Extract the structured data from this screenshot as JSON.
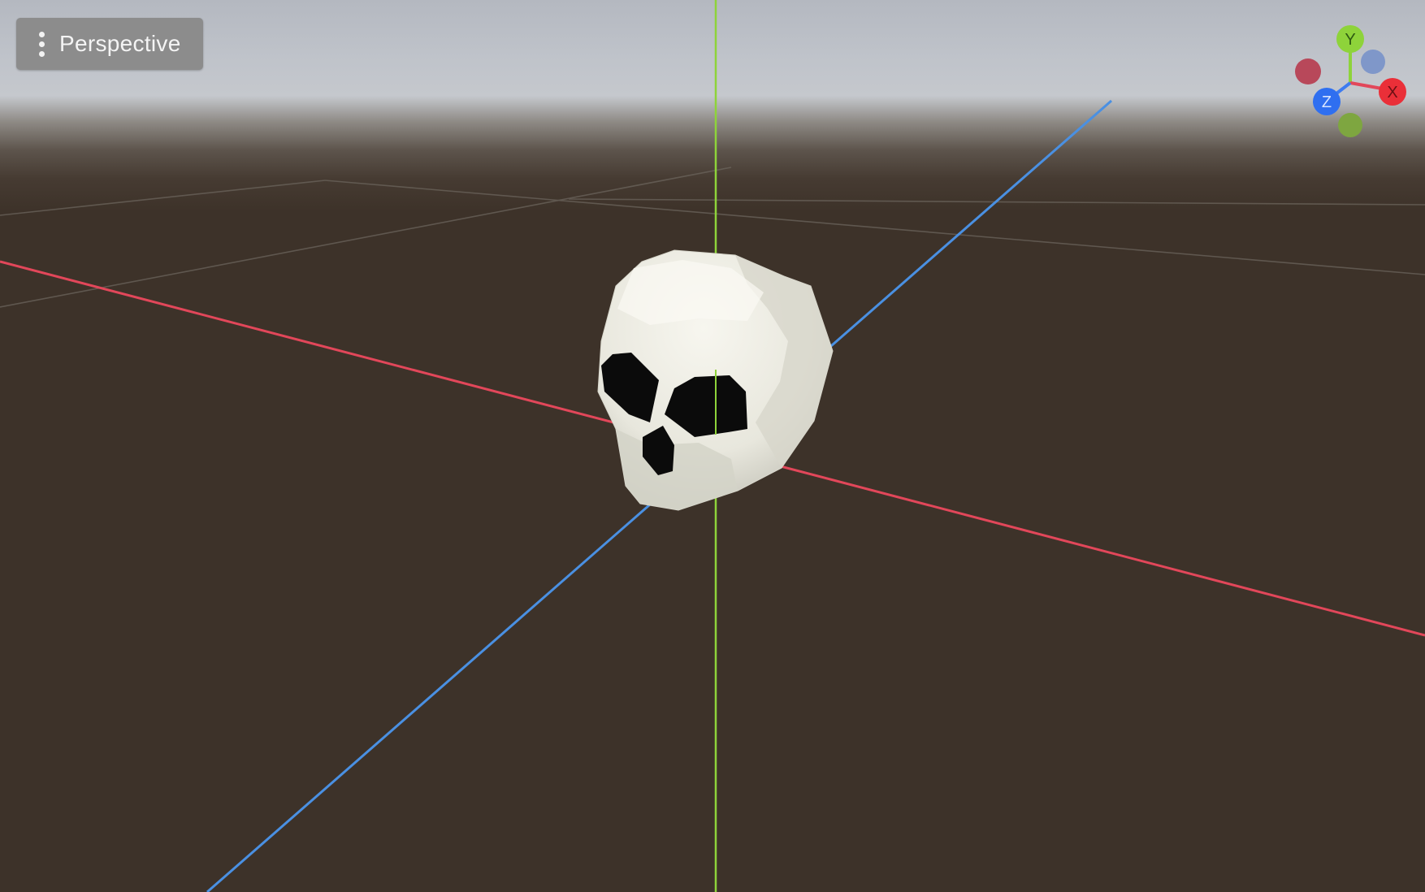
{
  "viewport": {
    "view_mode": "Perspective"
  },
  "axis_gizmo": {
    "x_label": "X",
    "y_label": "Y",
    "z_label": "Z"
  },
  "colors": {
    "x_axis": "#e2475a",
    "y_axis": "#8ed33a",
    "z_axis": "#4a90e2",
    "ground": "#3d3229",
    "skull": "#ecebe2"
  },
  "icons": [
    "kebab-menu-icon",
    "orientation-gizmo-icon",
    "skull-model"
  ]
}
